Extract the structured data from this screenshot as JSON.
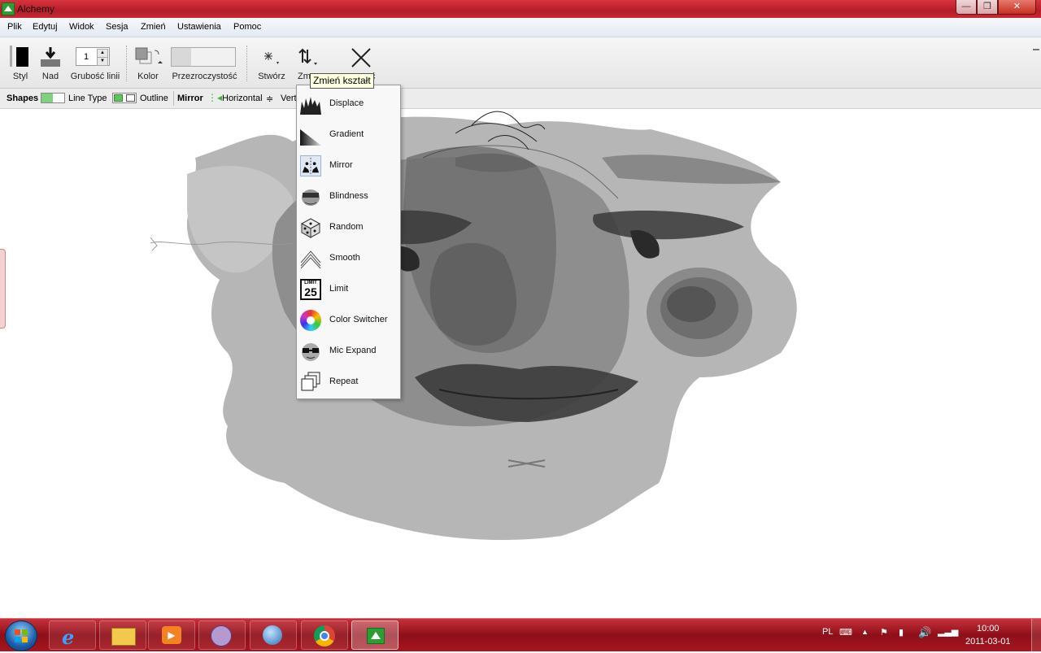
{
  "window": {
    "title": "Alchemy"
  },
  "menubar": [
    "Plik",
    "Edytuj",
    "Widok",
    "Sesja",
    "Zmień",
    "Ustawienia",
    "Pomoc"
  ],
  "toolbar": {
    "style_label": "Styl",
    "over_label": "Nad",
    "line_width_label": "Grubość linii",
    "line_width_value": "1",
    "color_label": "Kolor",
    "opacity_label": "Przezroczystość",
    "create_label": "Stwórz",
    "modify_label": "Zm",
    "clear_label_tail": "ć"
  },
  "tooltip": "Zmień kształt",
  "optionsbar": {
    "shapes_label": "Shapes",
    "line_type_label": "Line Type",
    "outline_label": "Outline",
    "mirror_label": "Mirror",
    "horizontal_label": "Horizontal",
    "vertical_label": "Vert"
  },
  "dropdown": {
    "items": [
      {
        "label": "Displace",
        "icon": "displace-icon"
      },
      {
        "label": "Gradient",
        "icon": "gradient-icon"
      },
      {
        "label": "Mirror",
        "icon": "mirror-icon",
        "selected": true
      },
      {
        "label": "Blindness",
        "icon": "blindness-icon"
      },
      {
        "label": "Random",
        "icon": "dice-icon"
      },
      {
        "label": "Smooth",
        "icon": "smooth-icon"
      },
      {
        "label": "Limit",
        "icon": "limit-icon",
        "badge_top": "LIMIT",
        "badge_num": "25"
      },
      {
        "label": "Color Switcher",
        "icon": "color-wheel-icon"
      },
      {
        "label": "Mic Expand",
        "icon": "mic-expand-icon"
      },
      {
        "label": "Repeat",
        "icon": "repeat-icon"
      }
    ]
  },
  "tray": {
    "language": "PL",
    "time": "10:00",
    "date": "2011-03-01"
  }
}
